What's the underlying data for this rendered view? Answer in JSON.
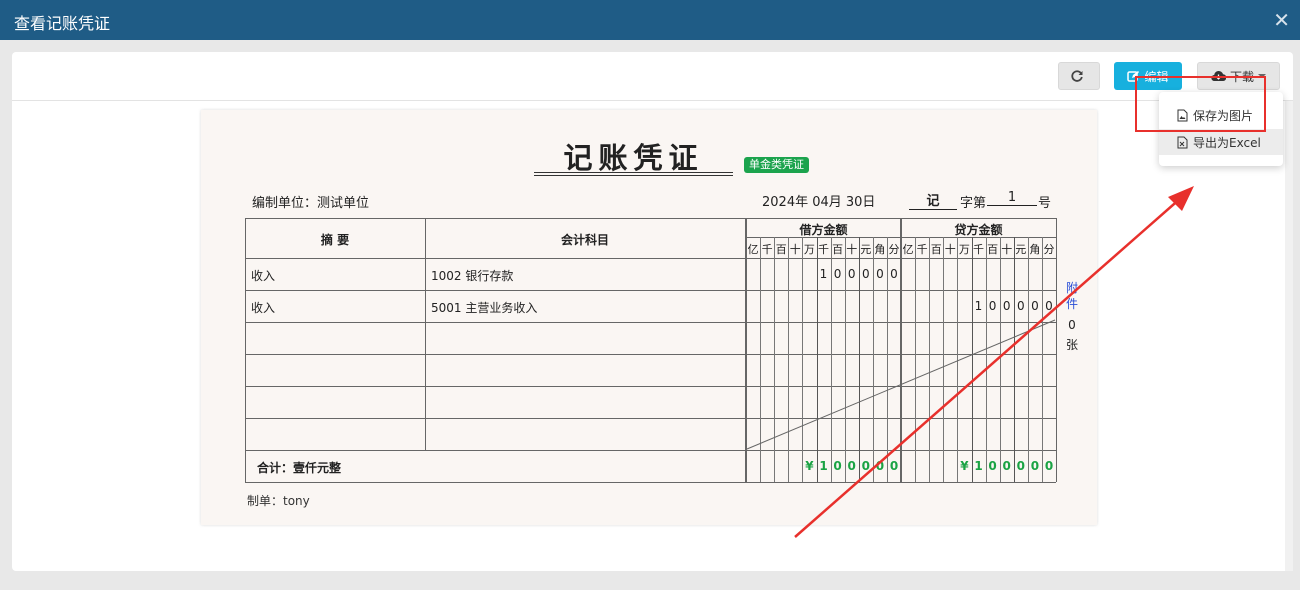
{
  "window": {
    "title": "查看记账凭证"
  },
  "toolbar": {
    "edit_label": "编辑",
    "download_label": "下载"
  },
  "dropdown": {
    "items": [
      "保存为图片",
      "导出为Excel"
    ]
  },
  "voucher": {
    "title": "记账凭证",
    "type_badge": "单金类凭证",
    "unit_label": "编制单位：测试单位",
    "date": "2024年 04月 30日",
    "word": "记",
    "word_suffix": "字第",
    "number": "1",
    "number_suffix": "号",
    "headers": {
      "summary": "摘 要",
      "account": "会计科目",
      "debit": "借方金额",
      "credit": "贷方金额"
    },
    "digit_headers": [
      "亿",
      "千",
      "百",
      "十",
      "万",
      "千",
      "百",
      "十",
      "元",
      "角",
      "分"
    ],
    "rows": [
      {
        "summary": "收入",
        "account": "1002 银行存款",
        "debit": [
          "",
          "",
          "",
          "",
          "",
          "1",
          "0",
          "0",
          "0",
          "0",
          "0"
        ],
        "credit": [
          "",
          "",
          "",
          "",
          "",
          "",
          "",
          "",
          "",
          "",
          ""
        ]
      },
      {
        "summary": "收入",
        "account": "5001 主营业务收入",
        "debit": [
          "",
          "",
          "",
          "",
          "",
          "",
          "",
          "",
          "",
          "",
          ""
        ],
        "credit": [
          "",
          "",
          "",
          "",
          "",
          "1",
          "0",
          "0",
          "0",
          "0",
          "0"
        ]
      }
    ],
    "total_label": "合计：壹仟元整",
    "total_debit": [
      "",
      "",
      "",
      "",
      "¥",
      "1",
      "0",
      "0",
      "0",
      "0",
      "0"
    ],
    "total_credit": [
      "",
      "",
      "",
      "",
      "¥",
      "1",
      "0",
      "0",
      "0",
      "0",
      "0"
    ],
    "attach": {
      "label1": "附",
      "label2": "件",
      "count": "0",
      "unit": "张"
    },
    "maker": "制单：tony"
  }
}
